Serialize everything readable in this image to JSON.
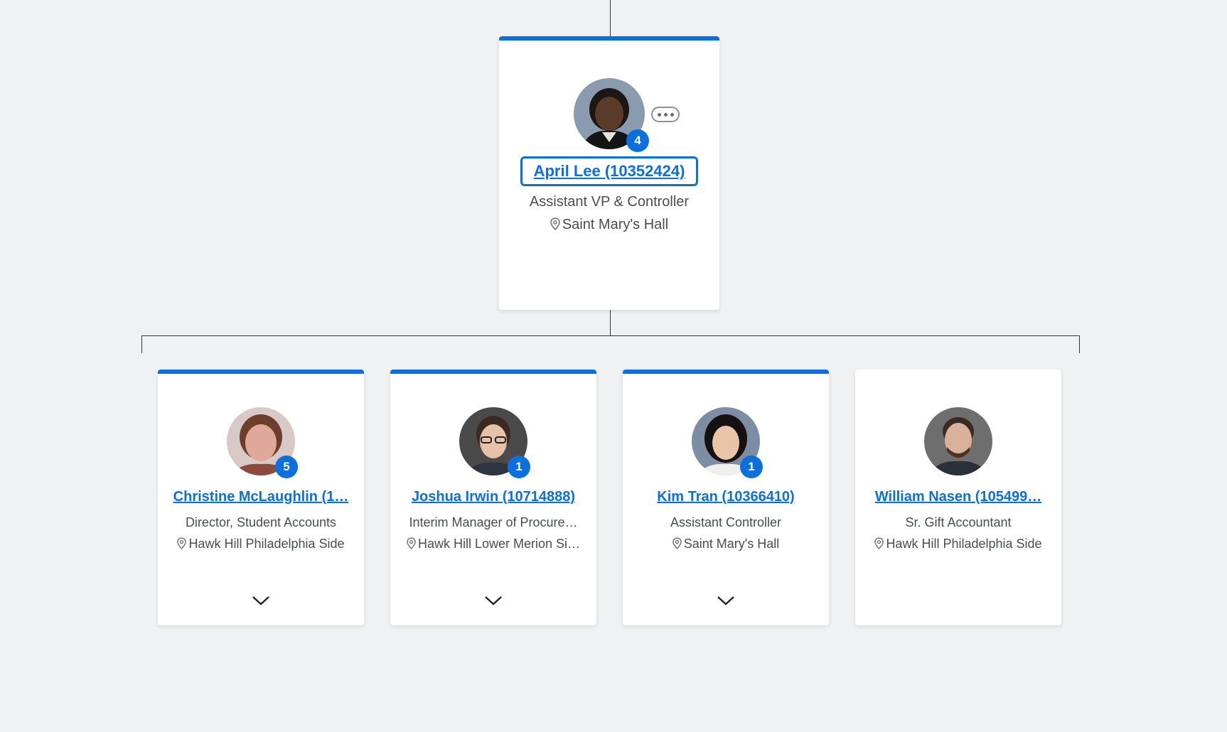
{
  "accent_color": "#0b6fde",
  "manager": {
    "name": "April Lee (10352424)",
    "title": "Assistant VP & Controller",
    "location": "Saint Mary's Hall",
    "direct_reports_count": "4",
    "has_accent_bar": true,
    "more_icon": "ellipsis-icon"
  },
  "reports": [
    {
      "name": "Christine McLaughlin (1…",
      "title": "Director, Student Accounts",
      "location": "Hawk Hill Philadelphia Side",
      "direct_reports_count": "5",
      "has_accent_bar": true,
      "expand_icon": "chevron-down-icon"
    },
    {
      "name": "Joshua Irwin (10714888)",
      "title": "Interim Manager of Procure…",
      "location": "Hawk Hill Lower Merion Si…",
      "direct_reports_count": "1",
      "has_accent_bar": true,
      "expand_icon": "chevron-down-icon"
    },
    {
      "name": "Kim Tran (10366410)",
      "title": "Assistant Controller",
      "location": "Saint Mary's Hall",
      "direct_reports_count": "1",
      "has_accent_bar": true,
      "expand_icon": "chevron-down-icon"
    },
    {
      "name": "William Nasen (105499…",
      "title": "Sr. Gift Accountant",
      "location": "Hawk Hill Philadelphia Side",
      "direct_reports_count": "",
      "has_accent_bar": false,
      "expand_icon": ""
    }
  ]
}
